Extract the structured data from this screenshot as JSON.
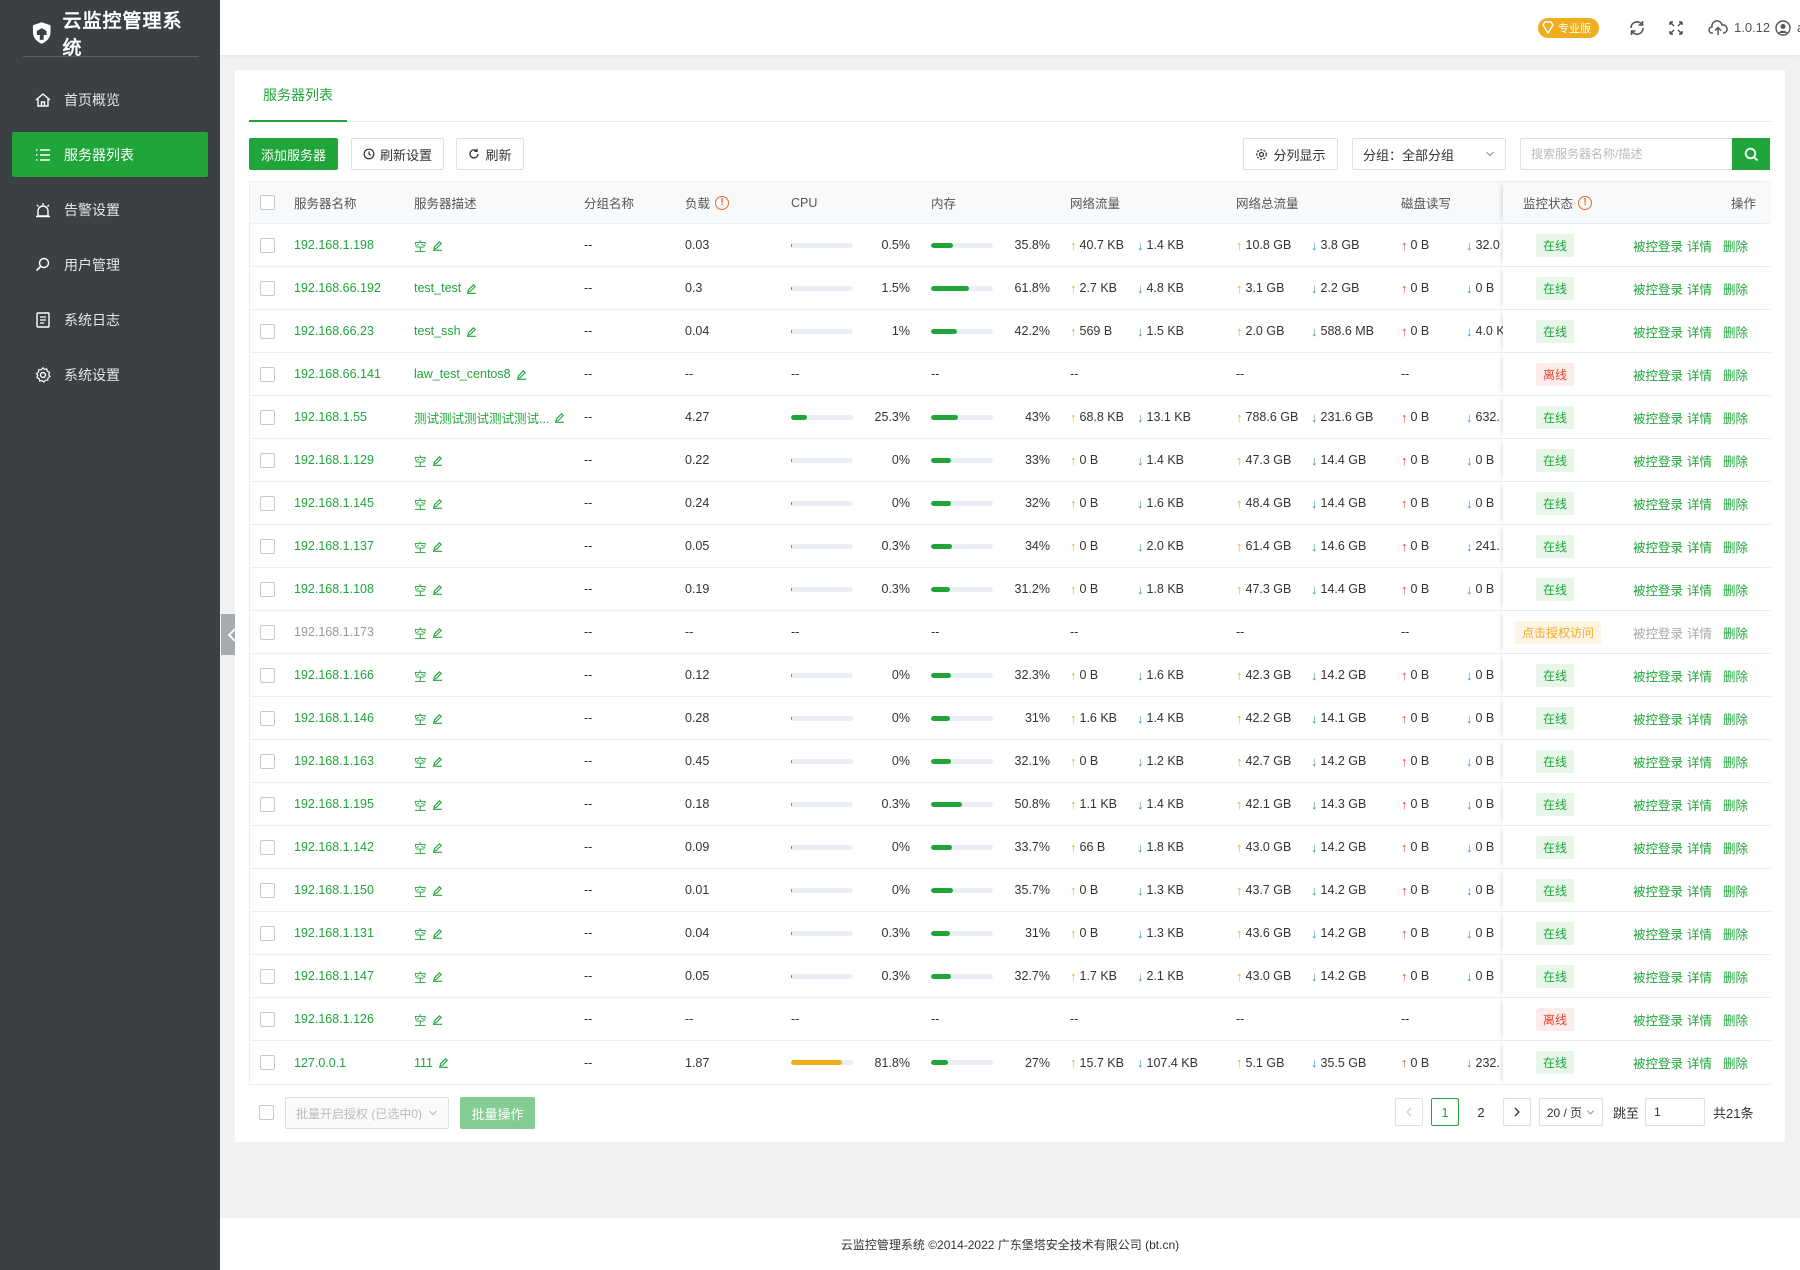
{
  "app": {
    "title": "云监控管理系统"
  },
  "menu": [
    {
      "label": "首页概览",
      "icon": "home-icon",
      "active": false
    },
    {
      "label": "服务器列表",
      "icon": "list-icon",
      "active": true
    },
    {
      "label": "告警设置",
      "icon": "alarm-icon",
      "active": false
    },
    {
      "label": "用户管理",
      "icon": "search-user-icon",
      "active": false
    },
    {
      "label": "系统日志",
      "icon": "log-icon",
      "active": false
    },
    {
      "label": "系统设置",
      "icon": "gear-icon",
      "active": false
    }
  ],
  "topbar": {
    "pro_label": "专业版",
    "version": "1.0.12",
    "user": "admin"
  },
  "tab": {
    "label": "服务器列表"
  },
  "toolbar": {
    "add_label": "添加服务器",
    "refresh_settings_label": "刷新设置",
    "refresh_label": "刷新",
    "column_label": "分列显示",
    "group_select": "分组：全部分组",
    "search_placeholder": "搜索服务器名称/描述"
  },
  "columns": {
    "name": "服务器名称",
    "desc": "服务器描述",
    "group": "分组名称",
    "load": "负载",
    "cpu": "CPU",
    "mem": "内存",
    "net": "网络流量",
    "net_total": "网络总流量",
    "disk": "磁盘读写",
    "status": "监控状态",
    "ops": "操作"
  },
  "ops": {
    "login": "被控登录",
    "detail": "详情",
    "delete": "删除"
  },
  "colors": {
    "accent": "#20a53a",
    "warning": "#f0ad1e",
    "danger": "#e8442e"
  },
  "rows": [
    {
      "name": "192.168.1.198",
      "desc": "空",
      "group": "--",
      "load": "0.03",
      "cpu": "0.5%",
      "cpu_pct": 0.5,
      "mem": "35.8%",
      "mem_pct": 35.8,
      "net_up": "40.7 KB",
      "net_down": "1.4 KB",
      "tot_up": "10.8 GB",
      "tot_down": "3.8 GB",
      "disk_r": "0 B",
      "disk_w": "32.0",
      "status": "在线",
      "st": "on"
    },
    {
      "name": "192.168.66.192",
      "desc": "test_test",
      "group": "--",
      "load": "0.3",
      "cpu": "1.5%",
      "cpu_pct": 1.5,
      "mem": "61.8%",
      "mem_pct": 61.8,
      "net_up": "2.7 KB",
      "net_down": "4.8 KB",
      "tot_up": "3.1 GB",
      "tot_down": "2.2 GB",
      "disk_r": "0 B",
      "disk_w": "0 B",
      "status": "在线",
      "st": "on"
    },
    {
      "name": "192.168.66.23",
      "desc": "test_ssh",
      "group": "--",
      "load": "0.04",
      "cpu": "1%",
      "cpu_pct": 1,
      "mem": "42.2%",
      "mem_pct": 42.2,
      "net_up": "569 B",
      "net_down": "1.5 KB",
      "tot_up": "2.0 GB",
      "tot_down": "588.6 MB",
      "disk_r": "0 B",
      "disk_w": "4.0 K",
      "status": "在线",
      "st": "on"
    },
    {
      "name": "192.168.66.141",
      "desc": "law_test_centos8",
      "group": "--",
      "load": "--",
      "cpu": "--",
      "cpu_pct": null,
      "mem": "--",
      "mem_pct": null,
      "net_up": "--",
      "net_down": "",
      "tot_up": "--",
      "tot_down": "",
      "disk_r": "--",
      "disk_w": "",
      "status": "离线",
      "st": "off"
    },
    {
      "name": "192.168.1.55",
      "desc": "测试测试测试测试测试...",
      "group": "--",
      "load": "4.27",
      "cpu": "25.3%",
      "cpu_pct": 25.3,
      "mem": "43%",
      "mem_pct": 43,
      "net_up": "68.8 KB",
      "net_down": "13.1 KB",
      "tot_up": "788.6 GB",
      "tot_down": "231.6 GB",
      "disk_r": "0 B",
      "disk_w": "632.",
      "status": "在线",
      "st": "on"
    },
    {
      "name": "192.168.1.129",
      "desc": "空",
      "group": "--",
      "load": "0.22",
      "cpu": "0%",
      "cpu_pct": 0,
      "mem": "33%",
      "mem_pct": 33,
      "net_up": "0 B",
      "net_down": "1.4 KB",
      "tot_up": "47.3 GB",
      "tot_down": "14.4 GB",
      "disk_r": "0 B",
      "disk_w": "0 B",
      "status": "在线",
      "st": "on"
    },
    {
      "name": "192.168.1.145",
      "desc": "空",
      "group": "--",
      "load": "0.24",
      "cpu": "0%",
      "cpu_pct": 0,
      "mem": "32%",
      "mem_pct": 32,
      "net_up": "0 B",
      "net_down": "1.6 KB",
      "tot_up": "48.4 GB",
      "tot_down": "14.4 GB",
      "disk_r": "0 B",
      "disk_w": "0 B",
      "status": "在线",
      "st": "on"
    },
    {
      "name": "192.168.1.137",
      "desc": "空",
      "group": "--",
      "load": "0.05",
      "cpu": "0.3%",
      "cpu_pct": 0.3,
      "mem": "34%",
      "mem_pct": 34,
      "net_up": "0 B",
      "net_down": "2.0 KB",
      "tot_up": "61.4 GB",
      "tot_down": "14.6 GB",
      "disk_r": "0 B",
      "disk_w": "241.",
      "status": "在线",
      "st": "on"
    },
    {
      "name": "192.168.1.108",
      "desc": "空",
      "group": "--",
      "load": "0.19",
      "cpu": "0.3%",
      "cpu_pct": 0.3,
      "mem": "31.2%",
      "mem_pct": 31.2,
      "net_up": "0 B",
      "net_down": "1.8 KB",
      "tot_up": "47.3 GB",
      "tot_down": "14.4 GB",
      "disk_r": "0 B",
      "disk_w": "0 B",
      "status": "在线",
      "st": "on"
    },
    {
      "name": "192.168.1.173",
      "desc": "空",
      "group": "--",
      "load": "--",
      "cpu": "--",
      "cpu_pct": null,
      "mem": "--",
      "mem_pct": null,
      "net_up": "--",
      "net_down": "",
      "tot_up": "--",
      "tot_down": "",
      "disk_r": "--",
      "disk_w": "",
      "status": "点击授权访问",
      "st": "auth"
    },
    {
      "name": "192.168.1.166",
      "desc": "空",
      "group": "--",
      "load": "0.12",
      "cpu": "0%",
      "cpu_pct": 0,
      "mem": "32.3%",
      "mem_pct": 32.3,
      "net_up": "0 B",
      "net_down": "1.6 KB",
      "tot_up": "42.3 GB",
      "tot_down": "14.2 GB",
      "disk_r": "0 B",
      "disk_w": "0 B",
      "status": "在线",
      "st": "on"
    },
    {
      "name": "192.168.1.146",
      "desc": "空",
      "group": "--",
      "load": "0.28",
      "cpu": "0%",
      "cpu_pct": 0,
      "mem": "31%",
      "mem_pct": 31,
      "net_up": "1.6 KB",
      "net_down": "1.4 KB",
      "tot_up": "42.2 GB",
      "tot_down": "14.1 GB",
      "disk_r": "0 B",
      "disk_w": "0 B",
      "status": "在线",
      "st": "on"
    },
    {
      "name": "192.168.1.163",
      "desc": "空",
      "group": "--",
      "load": "0.45",
      "cpu": "0%",
      "cpu_pct": 0,
      "mem": "32.1%",
      "mem_pct": 32.1,
      "net_up": "0 B",
      "net_down": "1.2 KB",
      "tot_up": "42.7 GB",
      "tot_down": "14.2 GB",
      "disk_r": "0 B",
      "disk_w": "0 B",
      "status": "在线",
      "st": "on"
    },
    {
      "name": "192.168.1.195",
      "desc": "空",
      "group": "--",
      "load": "0.18",
      "cpu": "0.3%",
      "cpu_pct": 0.3,
      "mem": "50.8%",
      "mem_pct": 50.8,
      "net_up": "1.1 KB",
      "net_down": "1.4 KB",
      "tot_up": "42.1 GB",
      "tot_down": "14.3 GB",
      "disk_r": "0 B",
      "disk_w": "0 B",
      "status": "在线",
      "st": "on"
    },
    {
      "name": "192.168.1.142",
      "desc": "空",
      "group": "--",
      "load": "0.09",
      "cpu": "0%",
      "cpu_pct": 0,
      "mem": "33.7%",
      "mem_pct": 33.7,
      "net_up": "66 B",
      "net_down": "1.8 KB",
      "tot_up": "43.0 GB",
      "tot_down": "14.2 GB",
      "disk_r": "0 B",
      "disk_w": "0 B",
      "status": "在线",
      "st": "on"
    },
    {
      "name": "192.168.1.150",
      "desc": "空",
      "group": "--",
      "load": "0.01",
      "cpu": "0%",
      "cpu_pct": 0,
      "mem": "35.7%",
      "mem_pct": 35.7,
      "net_up": "0 B",
      "net_down": "1.3 KB",
      "tot_up": "43.7 GB",
      "tot_down": "14.2 GB",
      "disk_r": "0 B",
      "disk_w": "0 B",
      "status": "在线",
      "st": "on"
    },
    {
      "name": "192.168.1.131",
      "desc": "空",
      "group": "--",
      "load": "0.04",
      "cpu": "0.3%",
      "cpu_pct": 0.3,
      "mem": "31%",
      "mem_pct": 31,
      "net_up": "0 B",
      "net_down": "1.3 KB",
      "tot_up": "43.6 GB",
      "tot_down": "14.2 GB",
      "disk_r": "0 B",
      "disk_w": "0 B",
      "status": "在线",
      "st": "on"
    },
    {
      "name": "192.168.1.147",
      "desc": "空",
      "group": "--",
      "load": "0.05",
      "cpu": "0.3%",
      "cpu_pct": 0.3,
      "mem": "32.7%",
      "mem_pct": 32.7,
      "net_up": "1.7 KB",
      "net_down": "2.1 KB",
      "tot_up": "43.0 GB",
      "tot_down": "14.2 GB",
      "disk_r": "0 B",
      "disk_w": "0 B",
      "status": "在线",
      "st": "on"
    },
    {
      "name": "192.168.1.126",
      "desc": "空",
      "group": "--",
      "load": "--",
      "cpu": "--",
      "cpu_pct": null,
      "mem": "--",
      "mem_pct": null,
      "net_up": "--",
      "net_down": "",
      "tot_up": "--",
      "tot_down": "",
      "disk_r": "--",
      "disk_w": "",
      "status": "离线",
      "st": "off"
    },
    {
      "name": "127.0.0.1",
      "desc": "111",
      "group": "--",
      "load": "1.87",
      "cpu": "81.8%",
      "cpu_pct": 81.8,
      "mem": "27%",
      "mem_pct": 27,
      "net_up": "15.7 KB",
      "net_down": "107.4 KB",
      "tot_up": "5.1 GB",
      "tot_down": "35.5 GB",
      "disk_r": "0 B",
      "disk_w": "232.",
      "status": "在线",
      "st": "on"
    }
  ],
  "bottom": {
    "batch_select": "批量开启授权 (已选中0)",
    "batch_button": "批量操作"
  },
  "pager": {
    "pages": [
      "1",
      "2"
    ],
    "current": "1",
    "page_size": "20 / 页",
    "jump_label": "跳至",
    "jump_value": "1",
    "total": "共21条"
  },
  "footer": {
    "text": "云监控管理系统 ©2014-2022 广东堡塔安全技术有限公司 (bt.cn)"
  }
}
